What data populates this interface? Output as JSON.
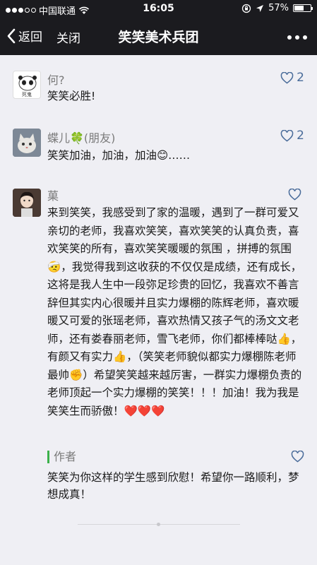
{
  "status_bar": {
    "carrier": "中国联通",
    "time": "16:05",
    "battery": "57%",
    "battery_level": 0.57,
    "signal_filled_dots": 3,
    "signal_total_dots": 5
  },
  "nav": {
    "back_label": "返回",
    "close_label": "关闭",
    "title": "笑笑美术兵团"
  },
  "comments": [
    {
      "name": "何?",
      "text": "笑笑必胜!",
      "likes": "2",
      "avatar_icon": "panda-avatar"
    },
    {
      "name": "蝶儿🍀(朋友)",
      "text": "笑笑加油，加油，加油😊……",
      "likes": "2",
      "avatar_icon": "cat-avatar"
    },
    {
      "name": "菓",
      "text": "来到笑笑，我感受到了家的温暖，遇到了一群可爱又亲切的老师，我喜欢笑笑，喜欢笑笑的认真负责，喜欢笑笑的所有，喜欢笑笑暖暖的氛围 ，拼搏的氛围🤕，我觉得我到这收获的不仅仅是成绩，还有成长，这将是我人生中一段弥足珍贵的回忆，我喜欢不善言辞但其实内心很暖并且实力爆棚的陈辉老师，喜欢暖暖又可爱的张瑶老师，喜欢热情又孩子气的汤文文老师，还有娄春丽老师，雪飞老师，你们都棒棒哒👍，有颜又有实力👍，（笑笑老师貌似都实力爆棚陈老师最帅✊）希望笑笑越来越厉害，一群实力爆棚负责的老师顶起一个实力爆棚的笑笑！！！加油！我为我是笑笑生而骄傲！❤️❤️❤️",
      "likes": "",
      "avatar_icon": "girl-avatar",
      "reply": {
        "label": "作者",
        "text": "笑笑为你这样的学生感到欣慰！希望你一路顺利，梦想成真！"
      }
    }
  ],
  "colors": {
    "bar": "#1b1b1f",
    "background": "#efeff4",
    "like": "#4a6c9a",
    "reply_accent": "#3bb14a"
  }
}
